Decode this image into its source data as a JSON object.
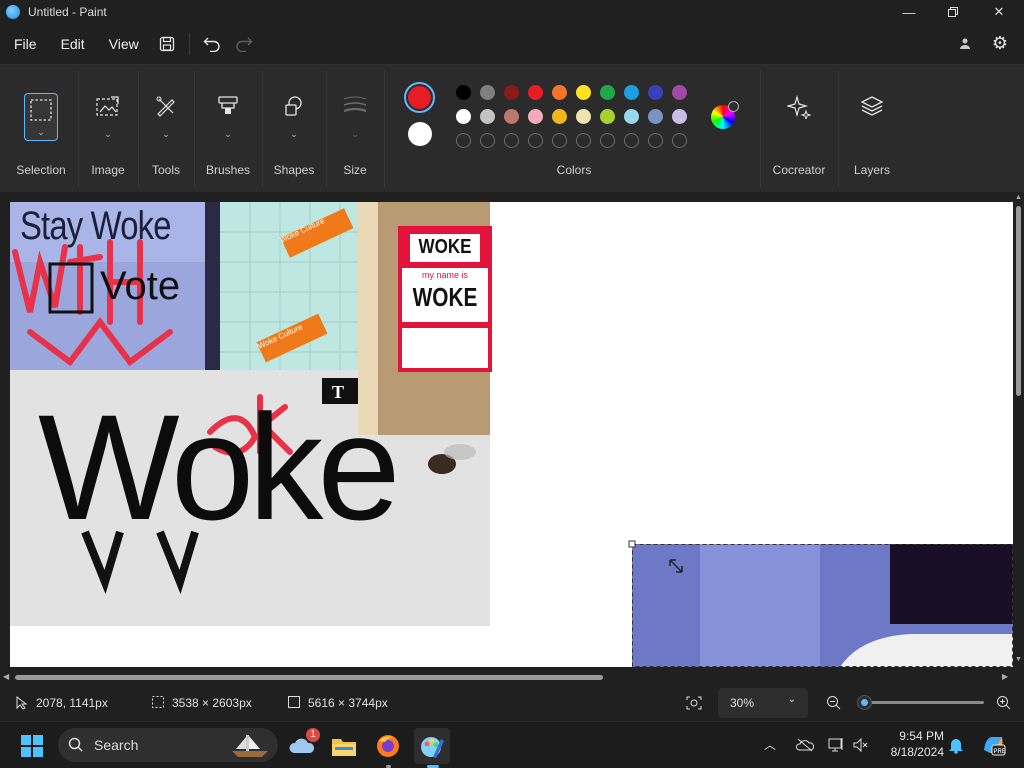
{
  "window": {
    "title": "Untitled - Paint"
  },
  "menu": {
    "file": "File",
    "edit": "Edit",
    "view": "View"
  },
  "ribbon": {
    "selection": "Selection",
    "image": "Image",
    "tools": "Tools",
    "brushes": "Brushes",
    "shapes": "Shapes",
    "size": "Size",
    "colors": "Colors",
    "cocreator": "Cocreator",
    "layers": "Layers",
    "primary_color": "#e81c24",
    "secondary_color": "#ffffff",
    "palette_row1": [
      "#000000",
      "#7f7f7f",
      "#8b1a1a",
      "#e81c24",
      "#f6742a",
      "#fde31c",
      "#1ea84a",
      "#1a9ee4",
      "#3b3fbf",
      "#a14aa3"
    ],
    "palette_row2": [
      "#ffffff",
      "#c3c3c3",
      "#b9786a",
      "#f5a9c0",
      "#f2b61c",
      "#efe4b0",
      "#a7d42c",
      "#98d7ec",
      "#7a93c3",
      "#c8bfe7"
    ]
  },
  "canvas": {
    "stay_woke": "Stay Woke",
    "vote": "Vote",
    "woke_big": "Woke",
    "oke_scribble": "oke",
    "badge_woke_top": "WOKE",
    "badge_name_is": "my name is",
    "badge_woke_bottom": "WOKE",
    "key_label": "Woke Culture"
  },
  "status": {
    "cursor": "2078, 1141px",
    "selection_size": "3538 × 2603px",
    "canvas_size": "5616 × 3744px",
    "zoom": "30%",
    "zoom_level": 0.05
  },
  "taskbar": {
    "search_placeholder": "Search",
    "weather_badge": "1",
    "time": "9:54 PM",
    "date": "8/18/2024"
  }
}
